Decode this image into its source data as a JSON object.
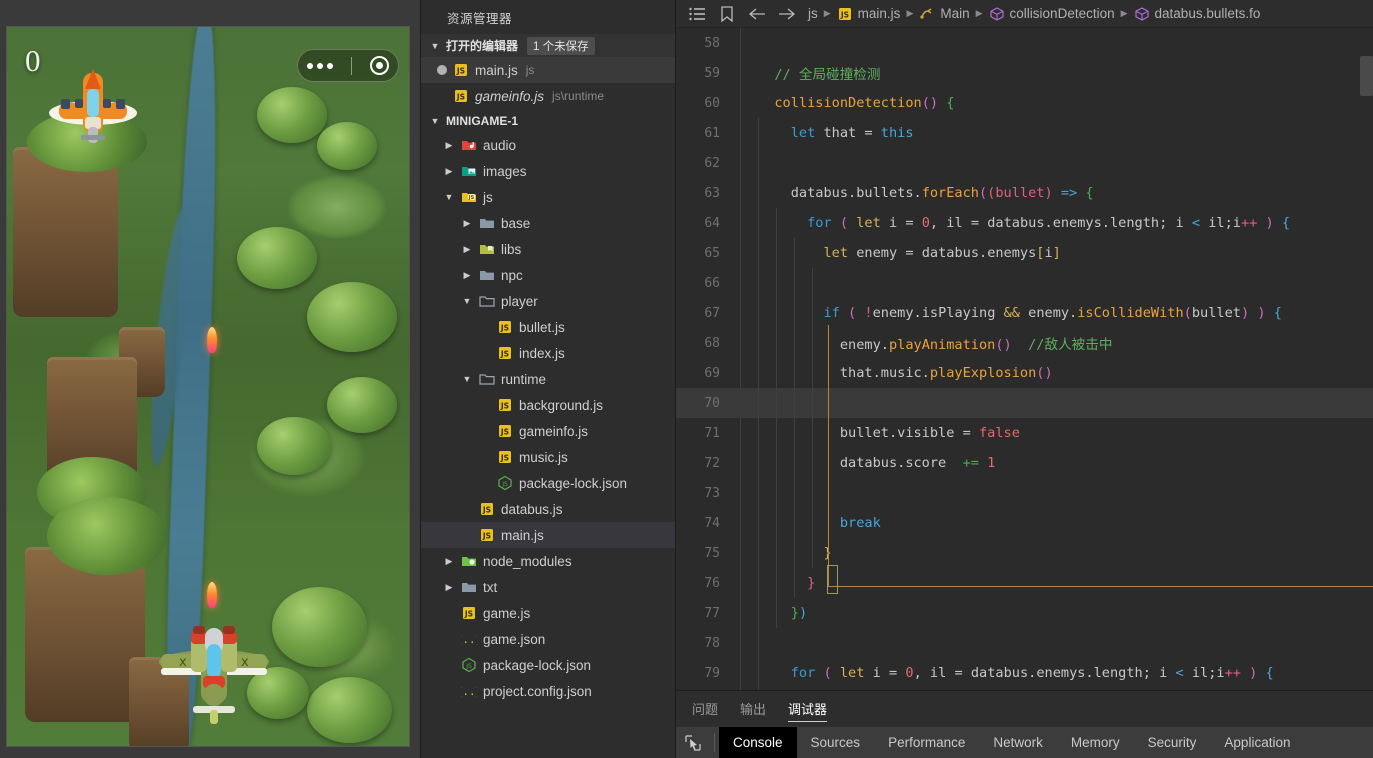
{
  "simulator": {
    "score": "0",
    "capsule": {
      "more_icon": "more-dots-icon",
      "target_icon": "target-circle-icon"
    }
  },
  "explorer": {
    "title": "资源管理器",
    "open_editors": {
      "label": "打开的编辑器",
      "badge": "1 个未保存",
      "items": [
        {
          "name": "main.js",
          "meta": "js",
          "unsaved": true,
          "italic": false,
          "icon": "js-file-icon",
          "selected": true
        },
        {
          "name": "gameinfo.js",
          "meta": "js\\runtime",
          "unsaved": false,
          "italic": true,
          "icon": "js-file-icon",
          "selected": false
        }
      ]
    },
    "project": {
      "label": "MINIGAME-1",
      "tree": [
        {
          "label": "audio",
          "type": "folder",
          "icon": "folder-audio-icon",
          "depth": 1,
          "expanded": false
        },
        {
          "label": "images",
          "type": "folder",
          "icon": "folder-images-icon",
          "depth": 1,
          "expanded": false
        },
        {
          "label": "js",
          "type": "folder",
          "icon": "folder-js-icon",
          "depth": 1,
          "expanded": true
        },
        {
          "label": "base",
          "type": "folder",
          "icon": "folder-icon",
          "depth": 2,
          "expanded": false
        },
        {
          "label": "libs",
          "type": "folder",
          "icon": "folder-libs-icon",
          "depth": 2,
          "expanded": false
        },
        {
          "label": "npc",
          "type": "folder",
          "icon": "folder-icon",
          "depth": 2,
          "expanded": false
        },
        {
          "label": "player",
          "type": "folder",
          "icon": "folder-open-icon",
          "depth": 2,
          "expanded": true
        },
        {
          "label": "bullet.js",
          "type": "file",
          "icon": "js-file-icon",
          "depth": 3
        },
        {
          "label": "index.js",
          "type": "file",
          "icon": "js-file-icon",
          "depth": 3
        },
        {
          "label": "runtime",
          "type": "folder",
          "icon": "folder-open-icon",
          "depth": 2,
          "expanded": true
        },
        {
          "label": "background.js",
          "type": "file",
          "icon": "js-file-icon",
          "depth": 3
        },
        {
          "label": "gameinfo.js",
          "type": "file",
          "icon": "js-file-icon",
          "depth": 3
        },
        {
          "label": "music.js",
          "type": "file",
          "icon": "js-file-icon",
          "depth": 3
        },
        {
          "label": "package-lock.json",
          "type": "file",
          "icon": "node-json-icon",
          "depth": 3
        },
        {
          "label": "databus.js",
          "type": "file",
          "icon": "js-file-icon",
          "depth": 2
        },
        {
          "label": "main.js",
          "type": "file",
          "icon": "js-file-icon",
          "depth": 2,
          "selected": true
        },
        {
          "label": "node_modules",
          "type": "folder",
          "icon": "folder-node-icon",
          "depth": 1,
          "expanded": false
        },
        {
          "label": "txt",
          "type": "folder",
          "icon": "folder-icon",
          "depth": 1,
          "expanded": false
        },
        {
          "label": "game.js",
          "type": "file",
          "icon": "js-file-icon",
          "depth": 1
        },
        {
          "label": "game.json",
          "type": "file",
          "icon": "json-icon",
          "depth": 1
        },
        {
          "label": "package-lock.json",
          "type": "file",
          "icon": "node-json-icon",
          "depth": 1
        },
        {
          "label": "project.config.json",
          "type": "file",
          "icon": "json-icon",
          "depth": 1
        }
      ]
    }
  },
  "editor": {
    "toolbar_icons": [
      "outline-list-icon",
      "bookmark-icon",
      "back-arrow-icon",
      "forward-arrow-icon"
    ],
    "breadcrumb": [
      {
        "label": "js",
        "icon": ""
      },
      {
        "label": "main.js",
        "icon": "js-file-icon"
      },
      {
        "label": "Main",
        "icon": "class-icon"
      },
      {
        "label": "collisionDetection",
        "icon": "method-icon"
      },
      {
        "label": "databus.bullets.fo",
        "icon": "method-icon"
      }
    ],
    "first_line_number": 58,
    "current_line": 70,
    "lines": [
      {
        "n": 58,
        "tokens": []
      },
      {
        "n": 59,
        "tokens": [
          {
            "t": "  ",
            "c": "t-plain"
          },
          {
            "t": "// 全局碰撞检测",
            "c": "t-cmt"
          }
        ]
      },
      {
        "n": 60,
        "tokens": [
          {
            "t": "  ",
            "c": "t-plain"
          },
          {
            "t": "collisionDetection",
            "c": "t-fn"
          },
          {
            "t": "()",
            "c": "t-paren"
          },
          {
            "t": " ",
            "c": "t-plain"
          },
          {
            "t": "{",
            "c": "t-green"
          }
        ]
      },
      {
        "n": 61,
        "tokens": [
          {
            "t": "    ",
            "c": "t-plain"
          },
          {
            "t": "let",
            "c": "t-kw"
          },
          {
            "t": " that ",
            "c": "t-plain"
          },
          {
            "t": "=",
            "c": "t-op"
          },
          {
            "t": " ",
            "c": "t-plain"
          },
          {
            "t": "this",
            "c": "t-blue2"
          }
        ]
      },
      {
        "n": 62,
        "tokens": []
      },
      {
        "n": 63,
        "tokens": [
          {
            "t": "    databus.bullets.",
            "c": "t-plain"
          },
          {
            "t": "forEach",
            "c": "t-fn"
          },
          {
            "t": "(",
            "c": "t-paren"
          },
          {
            "t": "(",
            "c": "t-pink"
          },
          {
            "t": "bullet",
            "c": "t-pink"
          },
          {
            "t": ")",
            "c": "t-pink"
          },
          {
            "t": " ",
            "c": "t-plain"
          },
          {
            "t": "=>",
            "c": "t-blue2"
          },
          {
            "t": " ",
            "c": "t-plain"
          },
          {
            "t": "{",
            "c": "t-green"
          }
        ]
      },
      {
        "n": 64,
        "tokens": [
          {
            "t": "      ",
            "c": "t-plain"
          },
          {
            "t": "for",
            "c": "t-kw"
          },
          {
            "t": " ",
            "c": "t-plain"
          },
          {
            "t": "(",
            "c": "t-paren"
          },
          {
            "t": " ",
            "c": "t-plain"
          },
          {
            "t": "let",
            "c": "t-brace"
          },
          {
            "t": " i ",
            "c": "t-plain"
          },
          {
            "t": "=",
            "c": "t-op"
          },
          {
            "t": " ",
            "c": "t-plain"
          },
          {
            "t": "0",
            "c": "t-num"
          },
          {
            "t": ", il ",
            "c": "t-plain"
          },
          {
            "t": "=",
            "c": "t-op"
          },
          {
            "t": " databus.enemys.length; i ",
            "c": "t-plain"
          },
          {
            "t": "<",
            "c": "t-blue2"
          },
          {
            "t": " il;i",
            "c": "t-plain"
          },
          {
            "t": "++",
            "c": "t-pink"
          },
          {
            "t": " ",
            "c": "t-plain"
          },
          {
            "t": ")",
            "c": "t-paren"
          },
          {
            "t": " ",
            "c": "t-plain"
          },
          {
            "t": "{",
            "c": "t-blue2"
          }
        ]
      },
      {
        "n": 65,
        "tokens": [
          {
            "t": "        ",
            "c": "t-plain"
          },
          {
            "t": "let",
            "c": "t-brace"
          },
          {
            "t": " enemy ",
            "c": "t-plain"
          },
          {
            "t": "=",
            "c": "t-op"
          },
          {
            "t": " databus.enemys",
            "c": "t-plain"
          },
          {
            "t": "[",
            "c": "t-brace"
          },
          {
            "t": "i",
            "c": "t-plain"
          },
          {
            "t": "]",
            "c": "t-brace"
          }
        ]
      },
      {
        "n": 66,
        "tokens": []
      },
      {
        "n": 67,
        "tokens": [
          {
            "t": "        ",
            "c": "t-plain"
          },
          {
            "t": "if",
            "c": "t-kw"
          },
          {
            "t": " ",
            "c": "t-plain"
          },
          {
            "t": "(",
            "c": "t-paren"
          },
          {
            "t": " ",
            "c": "t-plain"
          },
          {
            "t": "!",
            "c": "t-pink"
          },
          {
            "t": "enemy.",
            "c": "t-plain"
          },
          {
            "t": "isPlaying",
            "c": "t-plain"
          },
          {
            "t": " ",
            "c": "t-plain"
          },
          {
            "t": "&&",
            "c": "t-brace"
          },
          {
            "t": " enemy.",
            "c": "t-plain"
          },
          {
            "t": "isCollideWith",
            "c": "t-fn"
          },
          {
            "t": "(",
            "c": "t-paren"
          },
          {
            "t": "bullet",
            "c": "t-plain"
          },
          {
            "t": ")",
            "c": "t-paren"
          },
          {
            "t": " ",
            "c": "t-plain"
          },
          {
            "t": ")",
            "c": "t-paren"
          },
          {
            "t": " ",
            "c": "t-plain"
          },
          {
            "t": "{",
            "c": "t-blue2"
          }
        ]
      },
      {
        "n": 68,
        "tokens": [
          {
            "t": "          enemy.",
            "c": "t-plain"
          },
          {
            "t": "playAnimation",
            "c": "t-fn"
          },
          {
            "t": "()",
            "c": "t-paren"
          },
          {
            "t": "  ",
            "c": "t-plain"
          },
          {
            "t": "//敌人被击中",
            "c": "t-cmt"
          }
        ]
      },
      {
        "n": 69,
        "tokens": [
          {
            "t": "          that.music.",
            "c": "t-plain"
          },
          {
            "t": "playExplosion",
            "c": "t-fn"
          },
          {
            "t": "()",
            "c": "t-paren"
          }
        ]
      },
      {
        "n": 70,
        "tokens": []
      },
      {
        "n": 71,
        "tokens": [
          {
            "t": "          bullet.visible ",
            "c": "t-plain"
          },
          {
            "t": "=",
            "c": "t-op"
          },
          {
            "t": " ",
            "c": "t-plain"
          },
          {
            "t": "false",
            "c": "t-num"
          }
        ]
      },
      {
        "n": 72,
        "tokens": [
          {
            "t": "          databus.score  ",
            "c": "t-plain"
          },
          {
            "t": "+=",
            "c": "t-green"
          },
          {
            "t": " ",
            "c": "t-plain"
          },
          {
            "t": "1",
            "c": "t-num"
          }
        ]
      },
      {
        "n": 73,
        "tokens": []
      },
      {
        "n": 74,
        "tokens": [
          {
            "t": "          ",
            "c": "t-plain"
          },
          {
            "t": "break",
            "c": "t-blue2"
          }
        ]
      },
      {
        "n": 75,
        "tokens": [
          {
            "t": "        ",
            "c": "t-plain"
          },
          {
            "t": "}",
            "c": "t-brace"
          }
        ]
      },
      {
        "n": 76,
        "tokens": [
          {
            "t": "      ",
            "c": "t-plain"
          },
          {
            "t": "}",
            "c": "t-pink"
          }
        ]
      },
      {
        "n": 77,
        "tokens": [
          {
            "t": "    ",
            "c": "t-plain"
          },
          {
            "t": "}",
            "c": "t-green"
          },
          {
            "t": ")",
            "c": "t-blue2"
          }
        ]
      },
      {
        "n": 78,
        "tokens": []
      },
      {
        "n": 79,
        "tokens": [
          {
            "t": "    ",
            "c": "t-plain"
          },
          {
            "t": "for",
            "c": "t-kw"
          },
          {
            "t": " ",
            "c": "t-plain"
          },
          {
            "t": "(",
            "c": "t-paren"
          },
          {
            "t": " ",
            "c": "t-plain"
          },
          {
            "t": "let",
            "c": "t-brace"
          },
          {
            "t": " i ",
            "c": "t-plain"
          },
          {
            "t": "=",
            "c": "t-op"
          },
          {
            "t": " ",
            "c": "t-plain"
          },
          {
            "t": "0",
            "c": "t-num"
          },
          {
            "t": ", il ",
            "c": "t-plain"
          },
          {
            "t": "=",
            "c": "t-op"
          },
          {
            "t": " databus.enemys.length; i ",
            "c": "t-plain"
          },
          {
            "t": "<",
            "c": "t-blue2"
          },
          {
            "t": " il;i",
            "c": "t-plain"
          },
          {
            "t": "++",
            "c": "t-pink"
          },
          {
            "t": " ",
            "c": "t-plain"
          },
          {
            "t": ")",
            "c": "t-paren"
          },
          {
            "t": " ",
            "c": "t-plain"
          },
          {
            "t": "{",
            "c": "t-blue2"
          }
        ]
      }
    ]
  },
  "bottom_panel": {
    "tabs": [
      {
        "label": "问题",
        "active": false
      },
      {
        "label": "输出",
        "active": false
      },
      {
        "label": "调试器",
        "active": true
      }
    ],
    "devtools": {
      "inspect_icon": "inspect-cursor-icon",
      "tabs": [
        {
          "label": "Console",
          "active": true
        },
        {
          "label": "Sources",
          "active": false
        },
        {
          "label": "Performance",
          "active": false
        },
        {
          "label": "Network",
          "active": false
        },
        {
          "label": "Memory",
          "active": false
        },
        {
          "label": "Security",
          "active": false
        },
        {
          "label": "Application",
          "active": false
        }
      ]
    }
  },
  "colors": {
    "editor_bg": "#2b2b2b",
    "sidebar_bg": "#2d2d2d",
    "selection": "#37373d",
    "comment_green": "#5faf5f",
    "keyword_blue": "#3d9ad1",
    "function_orange": "#e8a33d",
    "block_border": "#b08a3a"
  }
}
